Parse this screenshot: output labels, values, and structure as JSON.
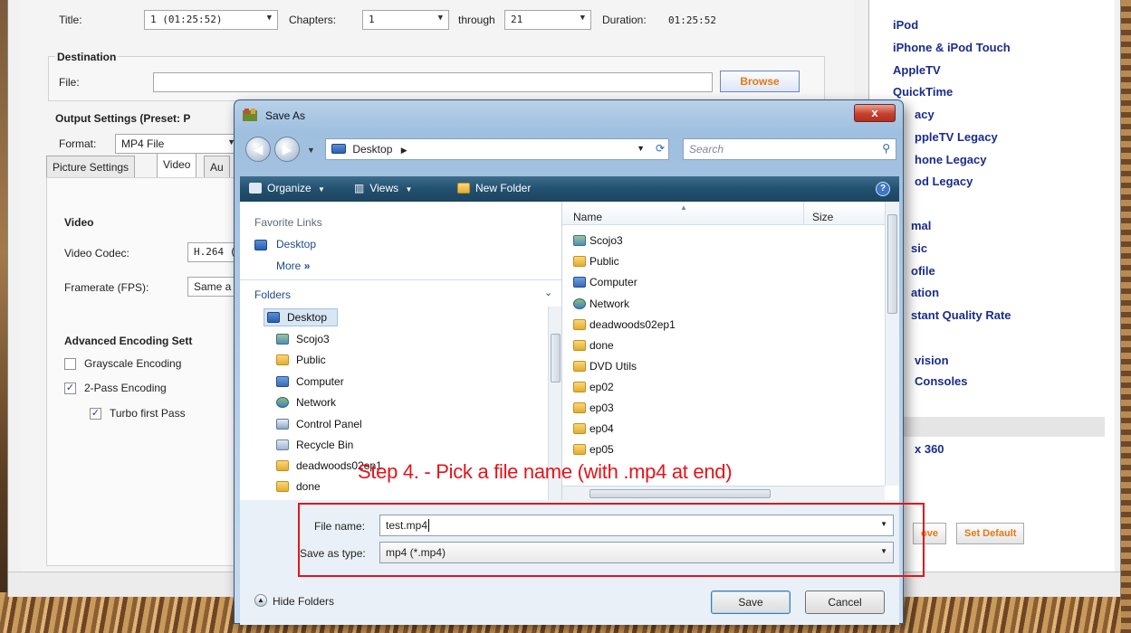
{
  "handbrake": {
    "source": {
      "title_label": "Title:",
      "title_value": "1 (01:25:52)",
      "chapters_label": "Chapters:",
      "chapter_start": "1",
      "through_label": "through",
      "chapter_end": "21",
      "duration_label": "Duration:",
      "duration_value": "01:25:52"
    },
    "destination": {
      "heading": "Destination",
      "file_label": "File:",
      "file_value": "",
      "browse_label": "Browse"
    },
    "output": {
      "heading": "Output Settings (Preset: P",
      "format_label": "Format:",
      "format_value": "MP4 File"
    },
    "tabs": [
      "Picture Settings",
      "Video",
      "Au"
    ],
    "video": {
      "heading": "Video",
      "codec_label": "Video Codec:",
      "codec_value": "H.264 (x",
      "framerate_label": "Framerate (FPS):",
      "framerate_value": "Same a",
      "advanced_heading": "Advanced Encoding Sett",
      "grayscale_label": "Grayscale Encoding",
      "twopass_label": "2-Pass Encoding",
      "turbo_label": "Turbo first Pass"
    },
    "presets": [
      "iPod",
      "iPhone & iPod Touch",
      "AppleTV",
      "QuickTime",
      "acy",
      "ppleTV Legacy",
      "hone Legacy",
      "od Legacy",
      "mal",
      "sic",
      "ofile",
      "ation",
      "stant Quality Rate",
      "vision",
      "Consoles",
      "x 360"
    ],
    "panel_buttons": {
      "remove": "ove",
      "set_default": "Set Default"
    }
  },
  "dialog": {
    "title": "Save As",
    "close_glyph": "x",
    "address_path": "Desktop",
    "search_placeholder": "Search",
    "toolbar": {
      "organize": "Organize",
      "views": "Views",
      "new_folder": "New Folder"
    },
    "favorite_links_heading": "Favorite Links",
    "favorite_links": [
      "Desktop",
      "More"
    ],
    "folders_heading": "Folders",
    "folder_tree": [
      "Desktop",
      "Scojo3",
      "Public",
      "Computer",
      "Network",
      "Control Panel",
      "Recycle Bin",
      "deadwoods02ep1",
      "done"
    ],
    "columns": {
      "name": "Name",
      "size": "Size"
    },
    "files": [
      "Scojo3",
      "Public",
      "Computer",
      "Network",
      "deadwoods02ep1",
      "done",
      "DVD Utils",
      "ep02",
      "ep03",
      "ep04",
      "ep05"
    ],
    "file_name_label": "File name:",
    "file_name_value": "test.mp4",
    "save_type_label": "Save as type:",
    "save_type_value": "mp4 (*.mp4)",
    "hide_folders_label": "Hide Folders",
    "save_label": "Save",
    "cancel_label": "Cancel"
  },
  "annotation": {
    "step_text": "Step 4. - Pick a file name (with .mp4 at end)",
    "color": "#e4141b"
  }
}
